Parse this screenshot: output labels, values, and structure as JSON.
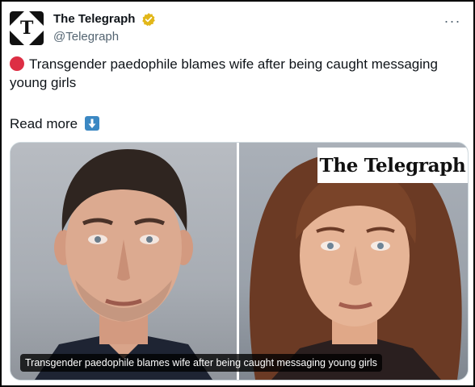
{
  "header": {
    "display_name": "The Telegraph",
    "handle": "@Telegraph",
    "avatar_letter": "T",
    "more_label": "···"
  },
  "tweet": {
    "text": "Transgender paedophile blames wife after being caught messaging young girls",
    "read_more": "Read more"
  },
  "media": {
    "watermark": "The Telegraph",
    "caption": "Transgender paedophile blames wife after being caught messaging young girls"
  },
  "icons": {
    "verified": "verified-gold-badge-icon",
    "more": "more-horizontal-icon",
    "red_circle": "red-circle-emoji-icon",
    "down_arrow": "down-arrow-emoji-icon"
  },
  "colors": {
    "verified_gold": "#e2b719",
    "red_circle": "#dd2e44",
    "down_arrow_blue": "#3b88c3",
    "handle_gray": "#536471"
  }
}
